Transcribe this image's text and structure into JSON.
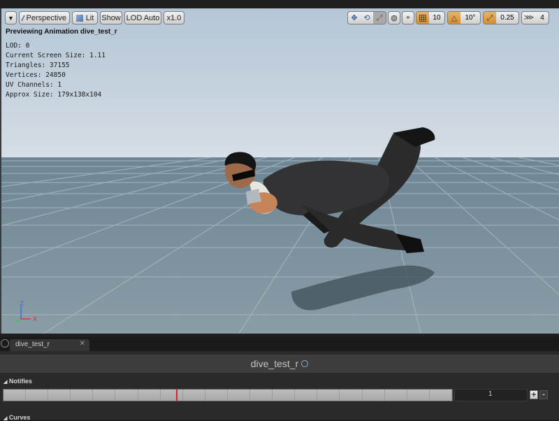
{
  "toolbar": {
    "perspective_label": "Perspective",
    "lit_label": "Lit",
    "show_label": "Show",
    "lod_label": "LOD Auto",
    "speed_label": "x1.0",
    "grid_snap_value": "10",
    "rotation_snap_value": "10°",
    "scale_snap_value": "0.25",
    "camera_speed_value": "4"
  },
  "viewport": {
    "preview_title": "Previewing Animation dive_test_r",
    "stats": [
      "LOD: 0",
      "Current Screen Size: 1.11",
      "Triangles: 37155",
      "Vertices: 24850",
      "UV Channels: 1",
      "Approx Size: 179x138x104"
    ],
    "axis_labels": {
      "z": "Z",
      "y": "Y",
      "x": "X"
    }
  },
  "tab": {
    "label": "dive_test_r"
  },
  "anim_panel": {
    "title": "dive_test_r",
    "notifies_label": "Notifies",
    "track_number": "1",
    "add_label": "+",
    "remove_label": "-",
    "curves_label": "Curves"
  },
  "colors": {
    "accent_orange": "#d9993f",
    "playhead": "#c92a2a"
  }
}
